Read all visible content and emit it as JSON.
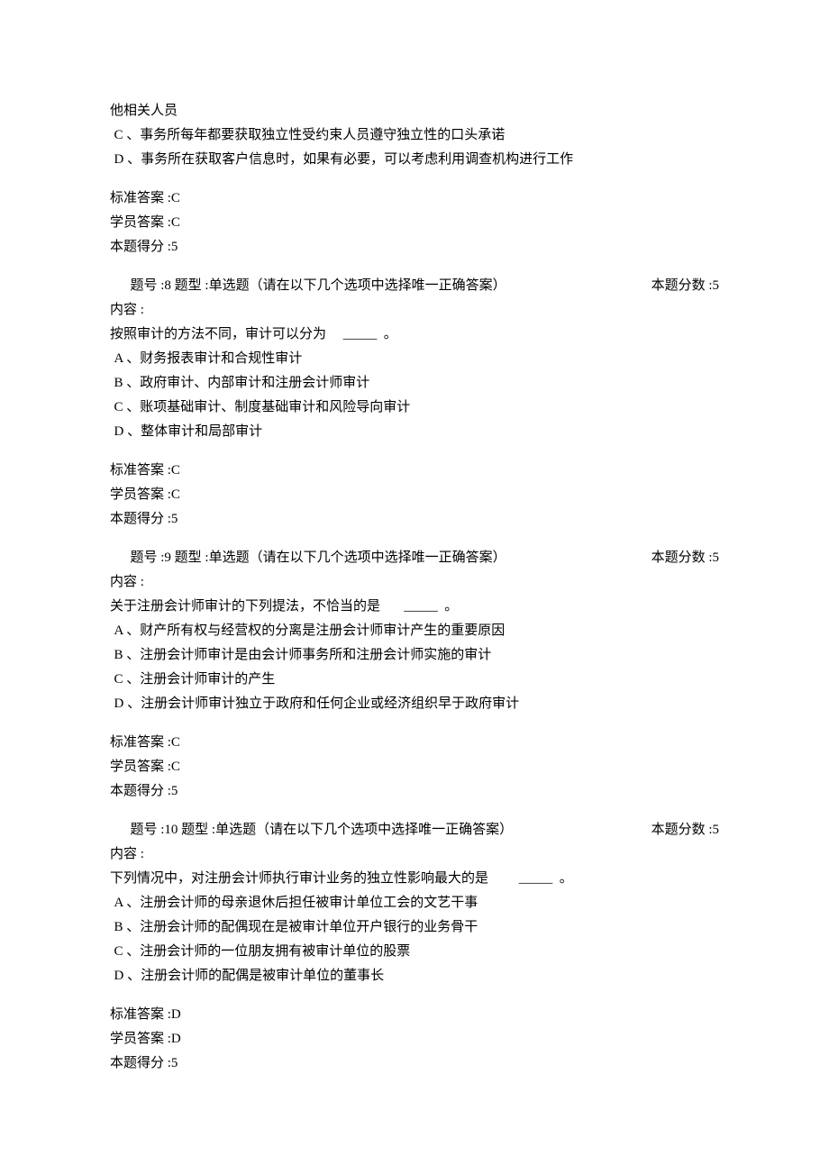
{
  "q7_tail": {
    "partial_line": "他相关人员",
    "options": [
      "C 、事务所每年都要获取独立性受约束人员遵守独立性的口头承诺",
      "D 、事务所在获取客户信息时，如果有必要，可以考虑利用调查机构进行工作"
    ],
    "std_label": "标准答案",
    "std_value": ":C",
    "stu_label": "学员答案",
    "stu_value": ":C",
    "score_label": "本题得分",
    "score_value": ":5"
  },
  "q8": {
    "header_left": "题号 :8    题型 :单选题（请在以下几个选项中选择唯一正确答案）",
    "header_right": "本题分数 :5",
    "content_label": "内容 :",
    "stem_before": "按照审计的方法不同，审计可以分为",
    "stem_after": "。",
    "options": [
      "A 、财务报表审计和合规性审计",
      "B 、政府审计、内部审计和注册会计师审计",
      "C 、账项基础审计、制度基础审计和风险导向审计",
      "D 、整体审计和局部审计"
    ],
    "std_label": "标准答案",
    "std_value": ":C",
    "stu_label": "学员答案",
    "stu_value": ":C",
    "score_label": "本题得分",
    "score_value": ":5"
  },
  "q9": {
    "header_left": "题号 :9    题型 :单选题（请在以下几个选项中选择唯一正确答案）",
    "header_right": "本题分数 :5",
    "content_label": "内容 :",
    "stem_before": "关于注册会计师审计的下列提法，不恰当的是",
    "stem_after": "。",
    "options": [
      "A 、财产所有权与经营权的分离是注册会计师审计产生的重要原因",
      "B 、注册会计师审计是由会计师事务所和注册会计师实施的审计",
      "C 、注册会计师审计的产生",
      "D 、注册会计师审计独立于政府和任何企业或经济组织早于政府审计"
    ],
    "std_label": "标准答案",
    "std_value": ":C",
    "stu_label": "学员答案",
    "stu_value": ":C",
    "score_label": "本题得分",
    "score_value": ":5"
  },
  "q10": {
    "header_left": "题号 :10    题型 :单选题（请在以下几个选项中选择唯一正确答案）",
    "header_right": "本题分数 :5",
    "content_label": "内容 :",
    "stem_before": "下列情况中，对注册会计师执行审计业务的独立性影响最大的是",
    "stem_after": "。",
    "options": [
      "A 、注册会计师的母亲退休后担任被审计单位工会的文艺干事",
      "B 、注册会计师的配偶现在是被审计单位开户银行的业务骨干",
      "C 、注册会计师的一位朋友拥有被审计单位的股票",
      "D 、注册会计师的配偶是被审计单位的董事长"
    ],
    "std_label": "标准答案",
    "std_value": ":D",
    "stu_label": "学员答案",
    "stu_value": ":D",
    "score_label": "本题得分",
    "score_value": ":5"
  }
}
